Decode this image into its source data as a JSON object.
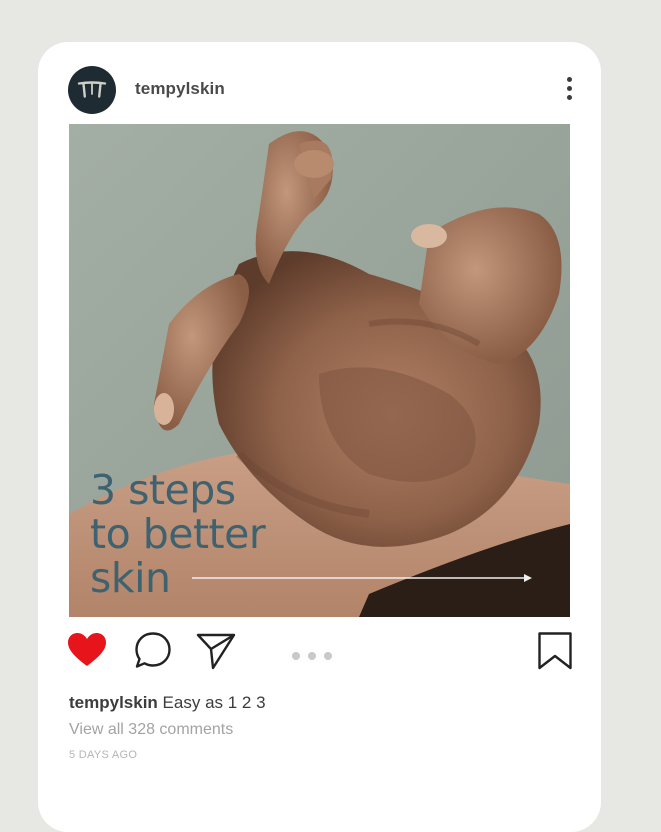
{
  "post": {
    "username": "tempylskin",
    "image": {
      "overlay_lines": [
        "3 steps",
        "to better",
        "skin"
      ]
    },
    "caption_username": "tempylskin",
    "caption_text": "Easy as 1 2 3",
    "view_comments": "View all 328 comments",
    "timestamp": "5 DAYS AGO",
    "liked": true
  },
  "icons": {
    "menu": "more-vertical-icon",
    "like": "heart-filled-icon",
    "comment": "comment-bubble-icon",
    "share": "send-paper-plane-icon",
    "carousel": "carousel-dots-indicator",
    "save": "bookmark-icon"
  },
  "colors": {
    "page_background": "#e7e8e3",
    "card_background": "#ffffff",
    "heart": "#e8141c",
    "overlay_text": "#3e6270",
    "avatar": "#1e2b33"
  }
}
